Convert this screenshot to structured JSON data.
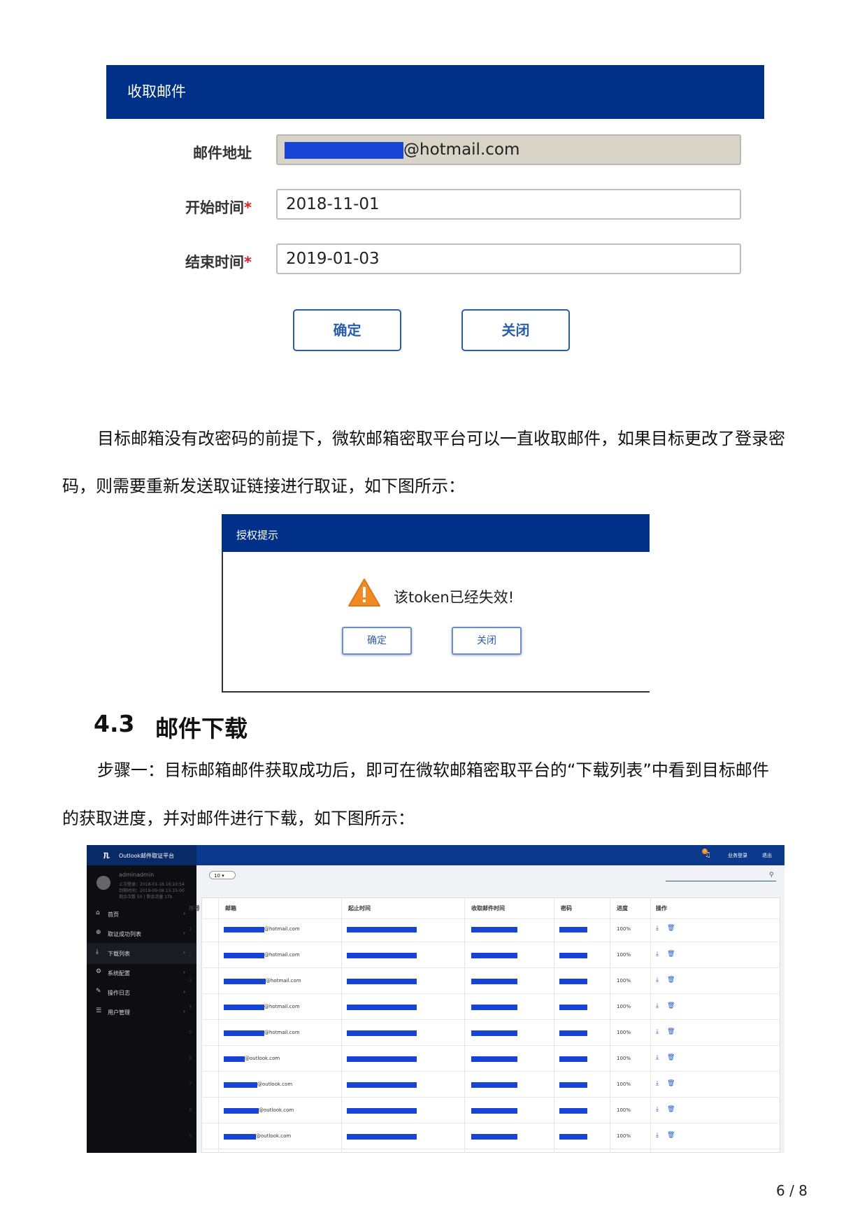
{
  "fig1": {
    "title": "收取邮件",
    "fields": [
      {
        "label": "邮件地址",
        "required": false,
        "value_visible": "@hotmail.com"
      },
      {
        "label": "开始时间",
        "required": true,
        "value": "2018-11-01"
      },
      {
        "label": "结束时间",
        "required": true,
        "value": "2019-01-03"
      }
    ],
    "required_mark": "*",
    "confirm_label": "确定",
    "close_label": "关闭"
  },
  "para1": {
    "line1": "目标邮箱没有改密码的前提下，微软邮箱密取平台可以一直收取邮件，如果目标更改了登录密",
    "line2": "码，则需要重新发送取证链接进行取证，如下图所示："
  },
  "fig2": {
    "title": "授权提示",
    "message": "该token已经失效!",
    "confirm_label": "确定",
    "close_label": "关闭",
    "warning_icon": "warning-triangle-icon"
  },
  "section": {
    "number": "4.3",
    "title": "邮件下载"
  },
  "para2": {
    "line1": "步骤一：目标邮箱邮件获取成功后，即可在微软邮箱密取平台的“下载列表”中看到目标邮件",
    "line2": "的获取进度，并对邮件进行下载，如下图所示："
  },
  "fig3": {
    "brand": "Outlook邮件取证平台",
    "topbar_links": [
      "业务登录",
      "退出"
    ],
    "notification_badge": "1",
    "user_name": "adminadmin",
    "user_meta": [
      "上次登录：2018-01-18 16:10:54",
      "到期时间：2019-09-08 15:15:00",
      "剩余次数 50 | 剩余流量 1Tb"
    ],
    "sidebar": [
      "首页",
      "取证成功列表",
      "下载列表",
      "系统配置",
      "操作日志",
      "用户管理"
    ],
    "active_sidebar_index": 2,
    "page_size": "10",
    "columns": [
      "序号",
      "邮箱",
      "起止时间",
      "收取邮件时间",
      "密码",
      "进度",
      "操作"
    ],
    "rows": [
      {
        "index": "1",
        "email_suffix": "@hotmail.com",
        "progress": "100%"
      },
      {
        "index": "2",
        "email_suffix": "@hotmail.com",
        "progress": "100%"
      },
      {
        "index": "3",
        "email_suffix": "@hotmail.com",
        "progress": "100%"
      },
      {
        "index": "4",
        "email_suffix": "@hotmail.com",
        "progress": "100%"
      },
      {
        "index": "5",
        "email_suffix": "@hotmail.com",
        "progress": "100%"
      },
      {
        "index": "6",
        "email_suffix": "@outlook.com",
        "progress": "100%"
      },
      {
        "index": "7",
        "email_suffix": "@outlook.com",
        "progress": "100%"
      },
      {
        "index": "8",
        "email_suffix": "@outlook.com",
        "progress": "100%"
      },
      {
        "index": "9",
        "email_suffix": "@outlook.com",
        "progress": "100%"
      }
    ],
    "row_icons": [
      "download-icon",
      "trash-icon"
    ]
  },
  "page_number": "6 / 8",
  "colors": {
    "header_blue": "#003087",
    "redaction_blue": "#1744d6",
    "sidebar_dark": "#0e0e12"
  }
}
